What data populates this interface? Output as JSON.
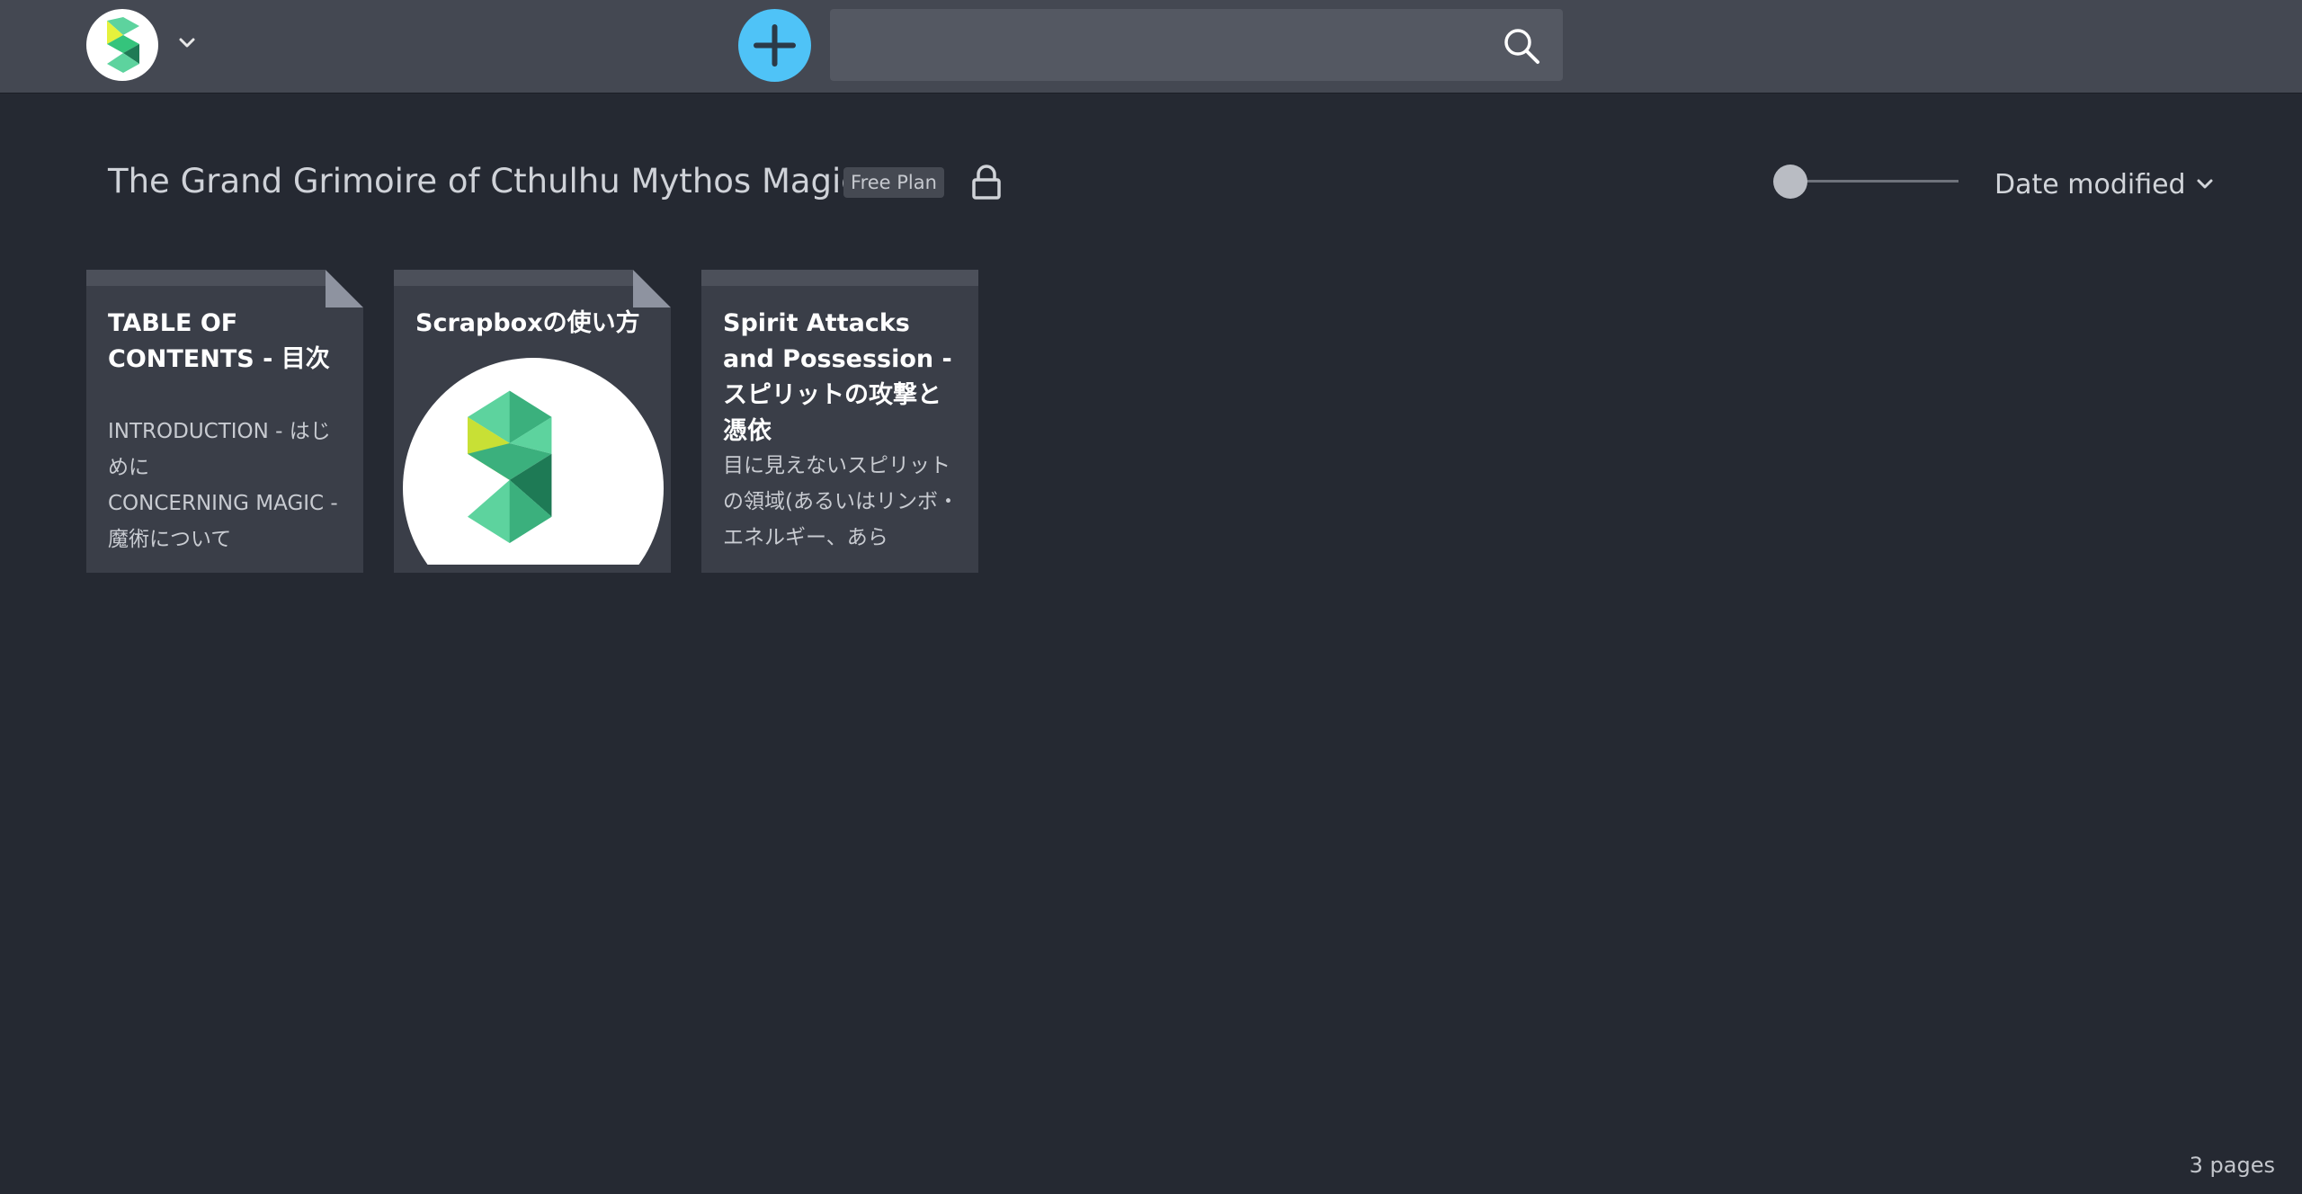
{
  "navbar": {
    "brand_icon": "scrapbox-logo-icon",
    "brand_menu_icon": "chevron-down-icon",
    "new_page_icon": "plus-icon",
    "search": {
      "value": "",
      "placeholder": ""
    },
    "search_icon": "search-icon"
  },
  "project": {
    "title": "The Grand Grimoire of Cthulhu Mythos Magic",
    "plan_badge": "Free Plan",
    "lock_icon": "lock-icon"
  },
  "controls": {
    "zoom_level": 0,
    "sort_label": "Date modified",
    "sort_icon": "chevron-down-icon"
  },
  "pages": [
    {
      "title": "TABLE OF CONTENTS - 目次",
      "description": "INTRODUCTION - はじめに\nCONCERNING MAGIC - 魔術について"
    },
    {
      "title": "Scrapboxの使い方",
      "thumbnail": "scrapbox-logo-icon"
    },
    {
      "title": "Spirit Attacks and Possession - スピリットの攻撃と憑依",
      "description": "目に見えないスピリットの領域(あるいはリンボ・エネルギー、あら"
    }
  ],
  "footer": {
    "page_count": "3 pages"
  },
  "colors": {
    "background": "#252932",
    "navbar": "#444852",
    "accent": "#4fc3f7",
    "card": "#3a3e48"
  }
}
